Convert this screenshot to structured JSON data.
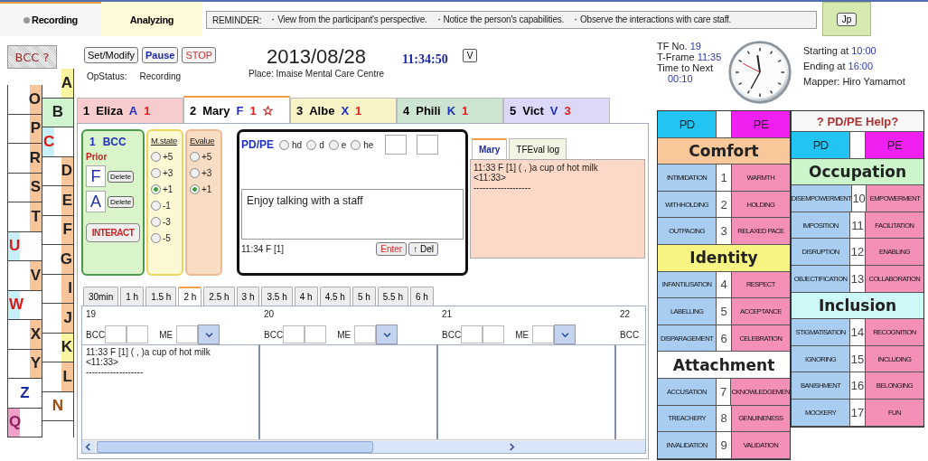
{
  "top_tabs": [
    {
      "label": "Recording",
      "kind": "recording",
      "selected": true
    },
    {
      "label": "Analyzing",
      "kind": "plain",
      "selected": false
    }
  ],
  "reminder": {
    "label": "REMINDER:",
    "points": [
      "・View from the participant's perspective.",
      "・Notice the person's capabilities.",
      "・Observe the interactions with care staff."
    ]
  },
  "language_button": "Jp",
  "letters": {
    "help_button": "BCC ?",
    "outer": [
      {
        "letter": "O",
        "kind": "right",
        "color": "#f8c49a"
      },
      {
        "letter": "P",
        "kind": "right",
        "color": "#f8c49a"
      },
      {
        "letter": "R",
        "kind": "right",
        "color": "#f8c49a"
      },
      {
        "letter": "S",
        "kind": "right",
        "color": "#f8c49a"
      },
      {
        "letter": "T",
        "kind": "right",
        "color": "#f8c49a"
      },
      {
        "letter": "U",
        "kind": "left",
        "color": "#c8f0f8"
      },
      {
        "letter": "V",
        "kind": "right",
        "color": "#f8c49a"
      },
      {
        "letter": "W",
        "kind": "left",
        "color": "#c8f0f8"
      },
      {
        "letter": "X",
        "kind": "right",
        "color": "#f8c49a"
      },
      {
        "letter": "Y",
        "kind": "right",
        "color": "#f8c49a"
      },
      {
        "letter": "Z",
        "kind": "blue"
      },
      {
        "letter": "Q",
        "kind": "pink",
        "color": "#f0a0c8"
      }
    ],
    "inner": [
      {
        "letter": "A",
        "kind": "right",
        "color": "#f8f4a0"
      },
      {
        "letter": "B",
        "kind": "full",
        "color": "#d0f4d0"
      },
      {
        "letter": "C",
        "kind": "left",
        "color": "#c8f0f8"
      },
      {
        "letter": "D",
        "kind": "right",
        "color": "#f8c49a"
      },
      {
        "letter": "E",
        "kind": "right",
        "color": "#f8c49a"
      },
      {
        "letter": "F",
        "kind": "right",
        "color": "#f8c49a"
      },
      {
        "letter": "G",
        "kind": "right",
        "color": "#f8c49a"
      },
      {
        "letter": "I",
        "kind": "right",
        "color": "#f8c49a"
      },
      {
        "letter": "J",
        "kind": "right",
        "color": "#f8c49a"
      },
      {
        "letter": "K",
        "kind": "right",
        "color": "#f8f4a0"
      },
      {
        "letter": "L",
        "kind": "right",
        "color": "#f8c49a"
      },
      {
        "letter": "N",
        "kind": "brown"
      }
    ]
  },
  "controls": {
    "buttons": [
      {
        "label": "Set/Modify",
        "kind": "plain"
      },
      {
        "label": "Pause",
        "kind": "blue"
      },
      {
        "label": "STOP",
        "kind": "red"
      }
    ],
    "status_label": "OpStatus:",
    "status_value": "Recording"
  },
  "session": {
    "date": "2013/08/28",
    "place": "Place: Imaise Mental Care Centre",
    "time": "11:34:50",
    "view_button": "V"
  },
  "participants": [
    {
      "number": "1",
      "name": "Eliza",
      "letter": "A",
      "count": "1",
      "color": "#f8cccc",
      "selected": false,
      "starred": false
    },
    {
      "number": "2",
      "name": "Mary",
      "letter": "F",
      "count": "1",
      "color": "#ffffff",
      "selected": true,
      "starred": true
    },
    {
      "number": "3",
      "name": "Albe",
      "letter": "X",
      "count": "1",
      "color": "#f8f4c8",
      "selected": false,
      "starred": false
    },
    {
      "number": "4",
      "name": "Phili",
      "letter": "K",
      "count": "1",
      "color": "#cce4d0",
      "selected": false,
      "starred": false
    },
    {
      "number": "5",
      "name": "Vict",
      "letter": "V",
      "count": "3",
      "color": "#dcd8f8",
      "selected": false,
      "starred": false
    }
  ],
  "bcc_card": {
    "number": "1",
    "title": "BCC",
    "subtitle": "Prior",
    "codes": [
      {
        "letter": "F",
        "button": "Delete"
      },
      {
        "letter": "A",
        "button": "Delete"
      }
    ],
    "action": "INTERACT"
  },
  "mstate": {
    "title": "M.state",
    "options": [
      {
        "label": "+5",
        "selected": false
      },
      {
        "label": "+3",
        "selected": false
      },
      {
        "label": "+1",
        "selected": true
      },
      {
        "label": "-1",
        "selected": false
      },
      {
        "label": "-3",
        "selected": false
      },
      {
        "label": "-5",
        "selected": false
      }
    ]
  },
  "evalue": {
    "title": "Evalue",
    "options": [
      {
        "label": "+5",
        "selected": false
      },
      {
        "label": "+3",
        "selected": false
      },
      {
        "label": "+1",
        "selected": true
      }
    ]
  },
  "pd_pe": {
    "title": "PD/PE",
    "options": [
      {
        "label": "hd",
        "selected": false
      },
      {
        "label": "d",
        "selected": false
      },
      {
        "label": "e",
        "selected": false
      },
      {
        "label": "he",
        "selected": false
      }
    ],
    "note": "Enjoy talking with a staff",
    "stamp": "11:34 F [1]",
    "buttons": [
      {
        "label": "Enter",
        "kind": "red"
      },
      {
        "label": "↑ Del",
        "kind": "plain"
      }
    ]
  },
  "log": {
    "tabs": [
      {
        "label": "Mary",
        "selected": true
      },
      {
        "label": "TFEval log",
        "selected": false
      }
    ],
    "lines": [
      "11:33 F [1] ( , )a cup of hot milk",
      "<11:33>",
      "-------------------"
    ]
  },
  "durations": [
    {
      "label": "30min",
      "selected": false
    },
    {
      "label": "1 h",
      "selected": false
    },
    {
      "label": "1.5 h",
      "selected": false
    },
    {
      "label": "2 h",
      "selected": true
    },
    {
      "label": "2.5 h",
      "selected": false
    },
    {
      "label": "3 h",
      "selected": false
    },
    {
      "label": "3.5 h",
      "selected": false
    },
    {
      "label": "4 h",
      "selected": false
    },
    {
      "label": "4.5 h",
      "selected": false
    },
    {
      "label": "5 h",
      "selected": false
    },
    {
      "label": "5.5 h",
      "selected": false
    },
    {
      "label": "6 h",
      "selected": false
    }
  ],
  "timeline": {
    "columns": [
      {
        "number": "19",
        "kind": "full",
        "bcc": "BCC",
        "me": "ME",
        "lines": [
          "11:33 F [1] ( , )a cup of hot milk",
          "<11:33>",
          "-------------------"
        ]
      },
      {
        "number": "20",
        "kind": "full",
        "bcc": "BCC",
        "me": "ME"
      },
      {
        "number": "21",
        "kind": "full",
        "bcc": "BCC",
        "me": "ME"
      },
      {
        "number": "22",
        "kind": "partial",
        "bcc": "BCC"
      }
    ]
  },
  "frame": {
    "tf_label": "TF No.",
    "tf": "19",
    "frame_label": "T-Frame",
    "frame": "11:35",
    "next_label": "Time to Next",
    "next": "00:10"
  },
  "schedule": {
    "start_label": "Starting at",
    "start": "10:00",
    "end_label": "Ending at",
    "end": "16:00",
    "mapper": "Mapper: Hiro Yamamot"
  },
  "grid": {
    "left": [
      {
        "kind": "header",
        "pd": "PD",
        "pe": "PE"
      },
      {
        "kind": "category",
        "title": "Comfort",
        "color": "#f9c89a"
      },
      {
        "kind": "item",
        "pd": "INTIMIDATION",
        "number": "1",
        "pe": "WARMTH"
      },
      {
        "kind": "item",
        "pd": "WITHHOLDING",
        "number": "2",
        "pe": "HOLDING"
      },
      {
        "kind": "item",
        "pd": "OUTPACING",
        "number": "3",
        "pe": "RELAXED PACE"
      },
      {
        "kind": "category",
        "title": "Identity",
        "color": "#f8f484"
      },
      {
        "kind": "item",
        "pd": "INFANTILISATION",
        "number": "4",
        "pe": "RESPECT"
      },
      {
        "kind": "item",
        "pd": "LABELLING",
        "number": "5",
        "pe": "ACCEPTANCE"
      },
      {
        "kind": "item",
        "pd": "DISPARAGEMENT",
        "number": "6",
        "pe": "CELEBRATION"
      },
      {
        "kind": "category",
        "title": "Attachment",
        "color": "#ffffff"
      },
      {
        "kind": "item",
        "pd": "ACCUSATION",
        "number": "7",
        "pe": "CKNOWLEDGEMEN"
      },
      {
        "kind": "item",
        "pd": "TREACHERY",
        "number": "8",
        "pe": "GENUINENESS"
      },
      {
        "kind": "item",
        "pd": "INVALIDATION",
        "number": "9",
        "pe": "VALIDATION"
      }
    ],
    "right": [
      {
        "kind": "help",
        "label": "? PD/PE Help?"
      },
      {
        "kind": "header",
        "pd": "PD",
        "pe": "PE"
      },
      {
        "kind": "category",
        "title": "Occupation",
        "color": "#ccf5cc"
      },
      {
        "kind": "item",
        "pd": "DISEMPOWERMENT",
        "number": "10",
        "pe": "EMPOWERMENT"
      },
      {
        "kind": "item",
        "pd": "IMPOSITION",
        "number": "11",
        "pe": "FACILITATION"
      },
      {
        "kind": "item",
        "pd": "DISRUPTION",
        "number": "12",
        "pe": "ENABLING"
      },
      {
        "kind": "item",
        "pd": "OBJECTIFICATION",
        "number": "13",
        "pe": "COLLABORATION"
      },
      {
        "kind": "category",
        "title": "Inclusion",
        "color": "#ccf8f8"
      },
      {
        "kind": "item",
        "pd": "STIGMATISATION",
        "number": "14",
        "pe": "RECOGNITION"
      },
      {
        "kind": "item",
        "pd": "IGNORING",
        "number": "15",
        "pe": "INCLUDING"
      },
      {
        "kind": "item",
        "pd": "BANISHMENT",
        "number": "16",
        "pe": "BELONGING"
      },
      {
        "kind": "item",
        "pd": "MOCKERY",
        "number": "17",
        "pe": "FUN"
      }
    ]
  }
}
